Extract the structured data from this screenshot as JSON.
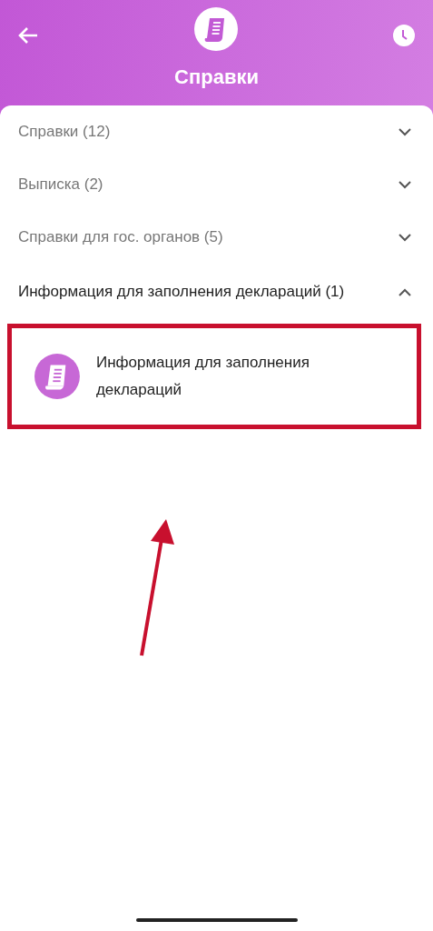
{
  "header": {
    "title": "Справки"
  },
  "sections": [
    {
      "label": "Справки (12)",
      "expanded": false
    },
    {
      "label": "Выписка (2)",
      "expanded": false
    },
    {
      "label": "Справки для гос. органов (5)",
      "expanded": false
    },
    {
      "label": "Информация для заполнения деклараций (1)",
      "expanded": true,
      "items": [
        {
          "label": "Информация для заполнения деклараций",
          "highlighted": true
        }
      ]
    }
  ]
}
